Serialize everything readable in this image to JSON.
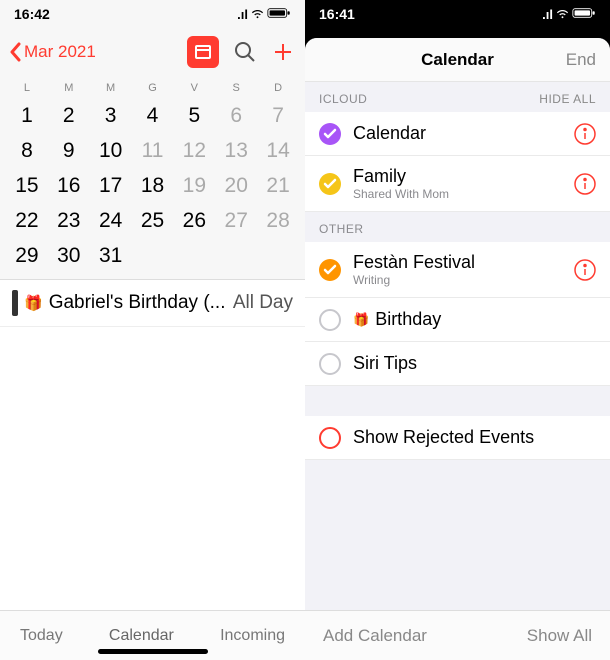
{
  "left": {
    "status": {
      "time": "16:42"
    },
    "header": {
      "month": "Mar 2021"
    },
    "weekdays": [
      "L",
      "M",
      "M",
      "G",
      "V",
      "S",
      "D"
    ],
    "grid": [
      {
        "d": "1"
      },
      {
        "d": "2"
      },
      {
        "d": "3"
      },
      {
        "d": "4"
      },
      {
        "d": "5"
      },
      {
        "d": "6",
        "w": true
      },
      {
        "d": "7",
        "w": true
      },
      {
        "d": "8"
      },
      {
        "d": "9"
      },
      {
        "d": "10"
      },
      {
        "d": "11",
        "w": true
      },
      {
        "d": "12",
        "w": true
      },
      {
        "d": "13",
        "w": true
      },
      {
        "d": "14",
        "w": true
      },
      {
        "d": "15"
      },
      {
        "d": "16"
      },
      {
        "d": "17"
      },
      {
        "d": "18"
      },
      {
        "d": "19",
        "w": true
      },
      {
        "d": "20",
        "w": true
      },
      {
        "d": "21",
        "w": true
      },
      {
        "d": "22"
      },
      {
        "d": "23"
      },
      {
        "d": "24"
      },
      {
        "d": "25"
      },
      {
        "d": "26",
        "today": true
      },
      {
        "d": "27",
        "w": true
      },
      {
        "d": "28",
        "w": true
      },
      {
        "d": "29"
      },
      {
        "d": "30"
      },
      {
        "d": "31"
      },
      {
        "d": ""
      },
      {
        "d": ""
      },
      {
        "d": ""
      },
      {
        "d": ""
      }
    ],
    "event": {
      "title": "Gabriel's Birthday (...",
      "time": "All Day"
    },
    "toolbar": {
      "today": "Today",
      "calendar": "Calendar",
      "incoming": "Incoming"
    }
  },
  "right": {
    "status": {
      "time": "16:41"
    },
    "sheet": {
      "title": "Calendar",
      "done": "End"
    },
    "sections": {
      "icloud": {
        "label": "ICLOUD",
        "hide": "HIDE ALL"
      },
      "other": {
        "label": "OTHER"
      }
    },
    "icloud_items": [
      {
        "name": "Calendar",
        "color": "#a855f7",
        "checked": true,
        "info": true
      },
      {
        "name": "Family",
        "sub": "Shared With Mom",
        "color": "#f5c518",
        "checked": true,
        "info": true
      }
    ],
    "other_items": [
      {
        "name": "Festàn Festival",
        "sub": "Writing",
        "color": "#ff9500",
        "checked": true,
        "info": true
      },
      {
        "name": "Birthday",
        "checked": false,
        "gift": true
      },
      {
        "name": "Siri Tips",
        "checked": false
      }
    ],
    "rejected": {
      "label": "Show Rejected Events"
    },
    "toolbar": {
      "add": "Add Calendar",
      "showall": "Show All"
    }
  }
}
